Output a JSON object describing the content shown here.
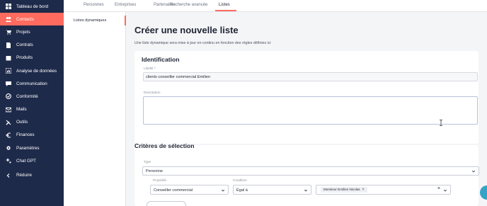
{
  "sidebar": {
    "items": [
      {
        "label": "Tableau de bord",
        "icon": "dashboard-icon"
      },
      {
        "label": "Contacts",
        "icon": "contacts-icon",
        "active": true
      },
      {
        "label": "Projets",
        "icon": "cart-icon"
      },
      {
        "label": "Contrats",
        "icon": "document-icon"
      },
      {
        "label": "Produits",
        "icon": "package-icon"
      },
      {
        "label": "Analyse de données",
        "icon": "chart-icon"
      },
      {
        "label": "Communication",
        "icon": "message-icon"
      },
      {
        "label": "Conformité",
        "icon": "check-circle-icon"
      },
      {
        "label": "Mails",
        "icon": "mail-icon"
      },
      {
        "label": "Outils",
        "icon": "tools-icon"
      },
      {
        "label": "Finances",
        "icon": "euro-icon"
      },
      {
        "label": "Paramètres",
        "icon": "gear-icon"
      },
      {
        "label": "Chat GPT",
        "icon": "sparkle-icon"
      },
      {
        "label": "Réduire",
        "icon": "chevron-left-icon"
      }
    ]
  },
  "tabs": [
    {
      "label": "Personnes"
    },
    {
      "label": "Entreprises"
    },
    {
      "label": "Partenaires"
    },
    {
      "label": "Recherche avancée"
    },
    {
      "label": "Listes",
      "active": true
    }
  ],
  "subnav": {
    "item": "Listes dynamiques"
  },
  "main": {
    "title": "Créer une nouvelle liste",
    "subtitle": "Une liste dynamique sera mise à jour en continu en fonction des règles définies ici",
    "identification": {
      "title": "Identification",
      "label_field_label": "Libellé *",
      "label_value": "clients conseiller commercial Emilien",
      "description_label": "Description",
      "description_value": ""
    },
    "criteria": {
      "title": "Critères de sélection",
      "type_label": "Type",
      "type_value": "Personne",
      "property_label": "Propriété",
      "property_value": "Conseiller commercial",
      "condition_label": "Condition",
      "condition_value": "Égal à",
      "value_chip": "Monsieur Emilien Nicolas"
    }
  },
  "colors": {
    "sidebar_bg": "#1e2a4a",
    "accent": "#ff6b5e",
    "page_bg": "#f4f5f7",
    "float_button": "#35a2c7"
  }
}
